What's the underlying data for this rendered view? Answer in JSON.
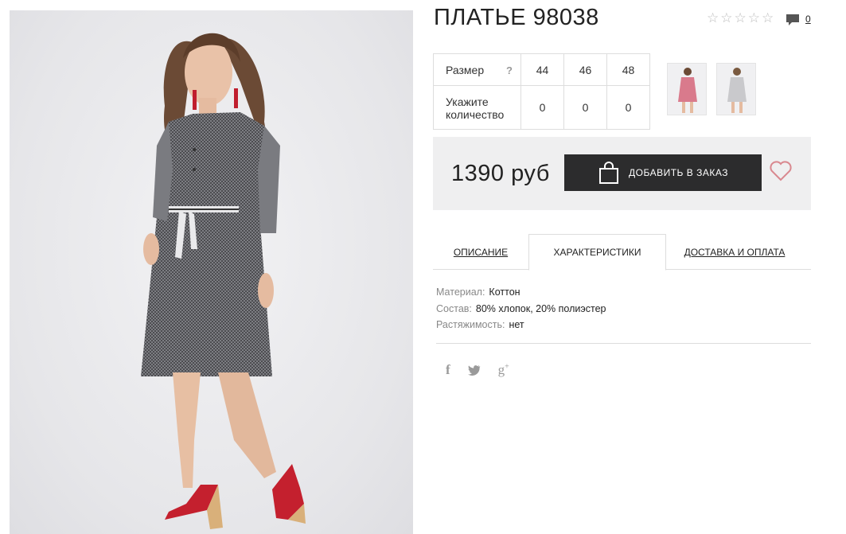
{
  "product": {
    "title": "ПЛАТЬЕ 98038",
    "rating_stars": 5,
    "comment_count": "0",
    "price": "1390 руб",
    "add_button_label": "ДОБАВИТЬ В ЗАКАЗ"
  },
  "size_table": {
    "size_label": "Размер",
    "help_mark": "?",
    "sizes": [
      "44",
      "46",
      "48"
    ],
    "qty_label": "Укажите количество",
    "quantities": [
      "0",
      "0",
      "0"
    ]
  },
  "tabs": {
    "description": "ОПИСАНИЕ",
    "characteristics": "ХАРАКТЕРИСТИКИ",
    "delivery": "ДОСТАВКА И ОПЛАТА"
  },
  "characteristics": [
    {
      "key": "Материал:",
      "value": "Коттон"
    },
    {
      "key": "Состав:",
      "value": "80% хлопок, 20% полиэстер"
    },
    {
      "key": "Растяжимость:",
      "value": "нет"
    }
  ],
  "social": {
    "facebook": "f",
    "twitter": "🐦",
    "google_plus": "g"
  },
  "colors": {
    "button_bg": "#2c2c2d",
    "buy_box_bg": "#efeff0",
    "heart": "#d9888f",
    "thumb_pink": "#d97a8c",
    "thumb_gray": "#c9c9cc"
  }
}
